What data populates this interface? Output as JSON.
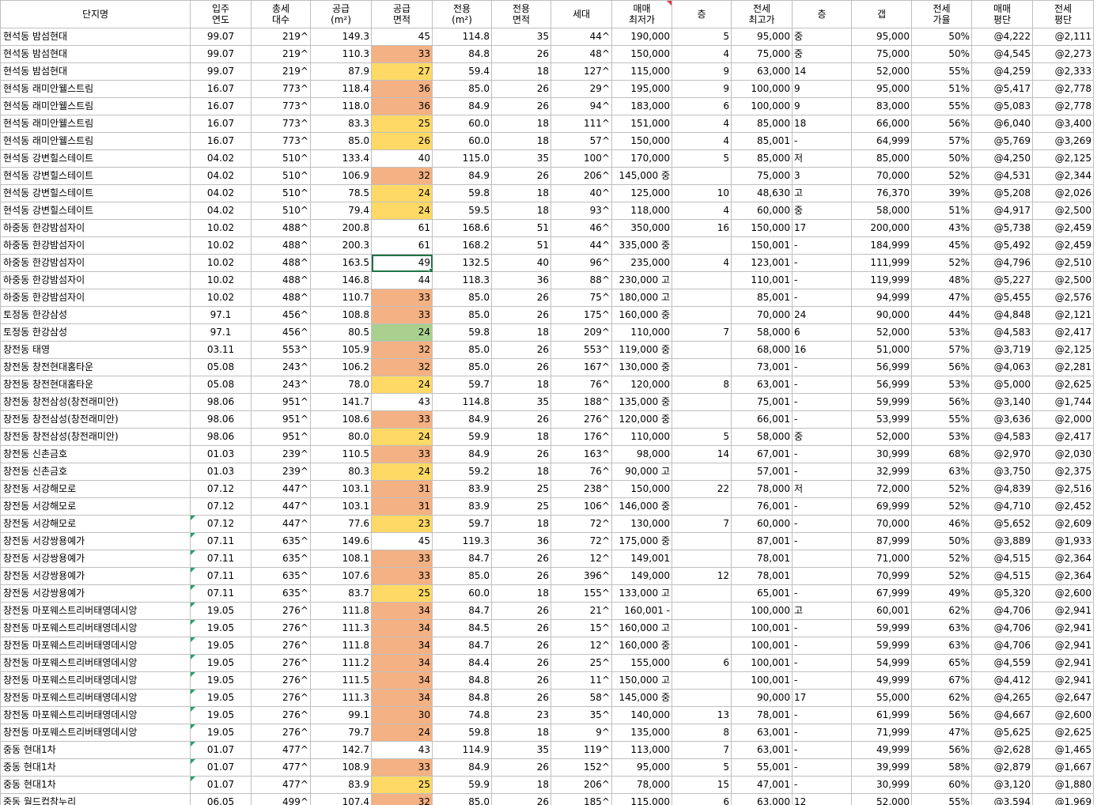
{
  "colors": {
    "orange": "#f4b183",
    "yellow": "#ffd966",
    "green": "#a9d08e",
    "select": "#217346",
    "note_marker": "#e23a3a",
    "error_marker": "#21a366"
  },
  "headers": [
    {
      "key": "name",
      "lines": [
        "단지명"
      ]
    },
    {
      "key": "year",
      "lines": [
        "입주",
        "연도"
      ]
    },
    {
      "key": "units",
      "lines": [
        "총세",
        "대수"
      ]
    },
    {
      "key": "supply",
      "lines": [
        "공급",
        "(m²)"
      ]
    },
    {
      "key": "supply_py",
      "lines": [
        "공급",
        "면적"
      ]
    },
    {
      "key": "excl",
      "lines": [
        "전용",
        "(m²)"
      ]
    },
    {
      "key": "excl_py",
      "lines": [
        "전용",
        "면적"
      ]
    },
    {
      "key": "hh",
      "lines": [
        "세대"
      ]
    },
    {
      "key": "sale_min",
      "lines": [
        "매매",
        "최저가"
      ]
    },
    {
      "key": "floor1",
      "lines": [
        "층"
      ]
    },
    {
      "key": "rent_max",
      "lines": [
        "전세",
        "최고가"
      ]
    },
    {
      "key": "floor2",
      "lines": [
        "층"
      ]
    },
    {
      "key": "gap",
      "lines": [
        "갭"
      ]
    },
    {
      "key": "rent_rate",
      "lines": [
        "전세",
        "가율"
      ]
    },
    {
      "key": "sale_pp",
      "lines": [
        "매매",
        "평단"
      ]
    },
    {
      "key": "rent_pp",
      "lines": [
        "전세",
        "평단"
      ]
    }
  ],
  "rows": [
    [
      "현석동 밤섬현대",
      "99.07",
      "219^",
      "149.3",
      "45",
      "114.8",
      "35",
      "44^",
      "190,000",
      "5",
      "95,000",
      "중",
      "95,000",
      "50%",
      "@4,222",
      "@2,111"
    ],
    [
      "현석동 밤섬현대",
      "99.07",
      "219^",
      "110.3",
      "33",
      "84.8",
      "26",
      "48^",
      "150,000",
      "4",
      "75,000",
      "중",
      "75,000",
      "50%",
      "@4,545",
      "@2,273"
    ],
    [
      "현석동 밤섬현대",
      "99.07",
      "219^",
      "87.9",
      "27",
      "59.4",
      "18",
      "127^",
      "115,000",
      "9",
      "63,000",
      "14",
      "52,000",
      "55%",
      "@4,259",
      "@2,333"
    ],
    [
      "현석동 래미안웰스트림",
      "16.07",
      "773^",
      "118.4",
      "36",
      "85.0",
      "26",
      "29^",
      "195,000",
      "9",
      "100,000",
      "9",
      "95,000",
      "51%",
      "@5,417",
      "@2,778"
    ],
    [
      "현석동 래미안웰스트림",
      "16.07",
      "773^",
      "118.0",
      "36",
      "84.9",
      "26",
      "94^",
      "183,000",
      "6",
      "100,000",
      "9",
      "83,000",
      "55%",
      "@5,083",
      "@2,778"
    ],
    [
      "현석동 래미안웰스트림",
      "16.07",
      "773^",
      "83.3",
      "25",
      "60.0",
      "18",
      "111^",
      "151,000",
      "4",
      "85,000",
      "18",
      "66,000",
      "56%",
      "@6,040",
      "@3,400"
    ],
    [
      "현석동 래미안웰스트림",
      "16.07",
      "773^",
      "85.0",
      "26",
      "60.0",
      "18",
      "57^",
      "150,000",
      "4",
      "85,001",
      "-",
      "64,999",
      "57%",
      "@5,769",
      "@3,269"
    ],
    [
      "현석동 강변힐스테이트",
      "04.02",
      "510^",
      "133.4",
      "40",
      "115.0",
      "35",
      "100^",
      "170,000",
      "5",
      "85,000",
      "저",
      "85,000",
      "50%",
      "@4,250",
      "@2,125"
    ],
    [
      "현석동 강변힐스테이트",
      "04.02",
      "510^",
      "106.9",
      "32",
      "84.9",
      "26",
      "206^",
      "145,000 중",
      "",
      "75,000",
      "3",
      "70,000",
      "52%",
      "@4,531",
      "@2,344"
    ],
    [
      "현석동 강변힐스테이트",
      "04.02",
      "510^",
      "78.5",
      "24",
      "59.8",
      "18",
      "40^",
      "125,000",
      "10",
      "48,630",
      "고",
      "76,370",
      "39%",
      "@5,208",
      "@2,026"
    ],
    [
      "현석동 강변힐스테이트",
      "04.02",
      "510^",
      "79.4",
      "24",
      "59.5",
      "18",
      "93^",
      "118,000",
      "4",
      "60,000",
      "중",
      "58,000",
      "51%",
      "@4,917",
      "@2,500"
    ],
    [
      "하중동 한강밤섬자이",
      "10.02",
      "488^",
      "200.8",
      "61",
      "168.6",
      "51",
      "46^",
      "350,000",
      "16",
      "150,000",
      "17",
      "200,000",
      "43%",
      "@5,738",
      "@2,459"
    ],
    [
      "하중동 한강밤섬자이",
      "10.02",
      "488^",
      "200.3",
      "61",
      "168.2",
      "51",
      "44^",
      "335,000 중",
      "",
      "150,001",
      "-",
      "184,999",
      "45%",
      "@5,492",
      "@2,459"
    ],
    [
      "하중동 한강밤섬자이",
      "10.02",
      "488^",
      "163.5",
      "49",
      "132.5",
      "40",
      "96^",
      "235,000",
      "4",
      "123,001",
      "-",
      "111,999",
      "52%",
      "@4,796",
      "@2,510"
    ],
    [
      "하중동 한강밤섬자이",
      "10.02",
      "488^",
      "146.8",
      "44",
      "118.3",
      "36",
      "88^",
      "230,000 고",
      "",
      "110,001",
      "-",
      "119,999",
      "48%",
      "@5,227",
      "@2,500"
    ],
    [
      "하중동 한강밤섬자이",
      "10.02",
      "488^",
      "110.7",
      "33",
      "85.0",
      "26",
      "75^",
      "180,000 고",
      "",
      "85,001",
      "-",
      "94,999",
      "47%",
      "@5,455",
      "@2,576"
    ],
    [
      "토정동 한강삼성",
      "97.1",
      "456^",
      "108.8",
      "33",
      "85.0",
      "26",
      "175^",
      "160,000 중",
      "",
      "70,000",
      "24",
      "90,000",
      "44%",
      "@4,848",
      "@2,121"
    ],
    [
      "토정동 한강삼성",
      "97.1",
      "456^",
      "80.5",
      "24",
      "59.8",
      "18",
      "209^",
      "110,000",
      "7",
      "58,000",
      "6",
      "52,000",
      "53%",
      "@4,583",
      "@2,417"
    ],
    [
      "창전동 태영",
      "03.11",
      "553^",
      "105.9",
      "32",
      "85.0",
      "26",
      "553^",
      "119,000 중",
      "",
      "68,000",
      "16",
      "51,000",
      "57%",
      "@3,719",
      "@2,125"
    ],
    [
      "창전동 창전현대홈타운",
      "05.08",
      "243^",
      "106.2",
      "32",
      "85.0",
      "26",
      "167^",
      "130,000 중",
      "",
      "73,001",
      "-",
      "56,999",
      "56%",
      "@4,063",
      "@2,281"
    ],
    [
      "창전동 창전현대홈타운",
      "05.08",
      "243^",
      "78.0",
      "24",
      "59.7",
      "18",
      "76^",
      "120,000",
      "8",
      "63,001",
      "-",
      "56,999",
      "53%",
      "@5,000",
      "@2,625"
    ],
    [
      "창전동 창전삼성(창전래미안)",
      "98.06",
      "951^",
      "141.7",
      "43",
      "114.8",
      "35",
      "188^",
      "135,000 중",
      "",
      "75,001",
      "-",
      "59,999",
      "56%",
      "@3,140",
      "@1,744"
    ],
    [
      "창전동 창전삼성(창전래미안)",
      "98.06",
      "951^",
      "108.6",
      "33",
      "84.9",
      "26",
      "276^",
      "120,000 중",
      "",
      "66,001",
      "-",
      "53,999",
      "55%",
      "@3,636",
      "@2,000"
    ],
    [
      "창전동 창전삼성(창전래미안)",
      "98.06",
      "951^",
      "80.0",
      "24",
      "59.9",
      "18",
      "176^",
      "110,000",
      "5",
      "58,000",
      "중",
      "52,000",
      "53%",
      "@4,583",
      "@2,417"
    ],
    [
      "창전동 신촌금호",
      "01.03",
      "239^",
      "110.5",
      "33",
      "84.9",
      "26",
      "163^",
      "98,000",
      "14",
      "67,001",
      "-",
      "30,999",
      "68%",
      "@2,970",
      "@2,030"
    ],
    [
      "창전동 신촌금호",
      "01.03",
      "239^",
      "80.3",
      "24",
      "59.2",
      "18",
      "76^",
      "90,000 고",
      "",
      "57,001",
      "-",
      "32,999",
      "63%",
      "@3,750",
      "@2,375"
    ],
    [
      "창전동 서강해모로",
      "07.12",
      "447^",
      "103.1",
      "31",
      "83.9",
      "25",
      "238^",
      "150,000",
      "22",
      "78,000",
      "저",
      "72,000",
      "52%",
      "@4,839",
      "@2,516"
    ],
    [
      "창전동 서강해모로",
      "07.12",
      "447^",
      "103.1",
      "31",
      "83.9",
      "25",
      "106^",
      "146,000 중",
      "",
      "76,001",
      "-",
      "69,999",
      "52%",
      "@4,710",
      "@2,452"
    ],
    [
      "창전동 서강해모로",
      "07.12",
      "447^",
      "77.6",
      "23",
      "59.7",
      "18",
      "72^",
      "130,000",
      "7",
      "60,000",
      "-",
      "70,000",
      "46%",
      "@5,652",
      "@2,609"
    ],
    [
      "창전동 서강쌍용예가",
      "07.11",
      "635^",
      "149.6",
      "45",
      "119.3",
      "36",
      "72^",
      "175,000 중",
      "",
      "87,001",
      "-",
      "87,999",
      "50%",
      "@3,889",
      "@1,933"
    ],
    [
      "창전동 서강쌍용예가",
      "07.11",
      "635^",
      "108.1",
      "33",
      "84.7",
      "26",
      "12^",
      "149,001",
      "",
      "78,001",
      "",
      "71,000",
      "52%",
      "@4,515",
      "@2,364"
    ],
    [
      "창전동 서강쌍용예가",
      "07.11",
      "635^",
      "107.6",
      "33",
      "85.0",
      "26",
      "396^",
      "149,000",
      "12",
      "78,001",
      "",
      "70,999",
      "52%",
      "@4,515",
      "@2,364"
    ],
    [
      "창전동 서강쌍용예가",
      "07.11",
      "635^",
      "83.7",
      "25",
      "60.0",
      "18",
      "155^",
      "133,000 고",
      "",
      "65,001",
      "-",
      "67,999",
      "49%",
      "@5,320",
      "@2,600"
    ],
    [
      "창전동 마포웨스트리버태영데시앙",
      "19.05",
      "276^",
      "111.8",
      "34",
      "84.7",
      "26",
      "21^",
      "160,001 -",
      "",
      "100,000",
      "고",
      "60,001",
      "62%",
      "@4,706",
      "@2,941"
    ],
    [
      "창전동 마포웨스트리버태영데시앙",
      "19.05",
      "276^",
      "111.3",
      "34",
      "84.5",
      "26",
      "15^",
      "160,000 고",
      "",
      "100,001",
      "-",
      "59,999",
      "63%",
      "@4,706",
      "@2,941"
    ],
    [
      "창전동 마포웨스트리버태영데시앙",
      "19.05",
      "276^",
      "111.8",
      "34",
      "84.7",
      "26",
      "12^",
      "160,000 중",
      "",
      "100,001",
      "-",
      "59,999",
      "63%",
      "@4,706",
      "@2,941"
    ],
    [
      "창전동 마포웨스트리버태영데시앙",
      "19.05",
      "276^",
      "111.2",
      "34",
      "84.4",
      "26",
      "25^",
      "155,000",
      "6",
      "100,001",
      "-",
      "54,999",
      "65%",
      "@4,559",
      "@2,941"
    ],
    [
      "창전동 마포웨스트리버태영데시앙",
      "19.05",
      "276^",
      "111.5",
      "34",
      "84.8",
      "26",
      "11^",
      "150,000 고",
      "",
      "100,001",
      "-",
      "49,999",
      "67%",
      "@4,412",
      "@2,941"
    ],
    [
      "창전동 마포웨스트리버태영데시앙",
      "19.05",
      "276^",
      "111.3",
      "34",
      "84.8",
      "26",
      "58^",
      "145,000 중",
      "",
      "90,000",
      "17",
      "55,000",
      "62%",
      "@4,265",
      "@2,647"
    ],
    [
      "창전동 마포웨스트리버태영데시앙",
      "19.05",
      "276^",
      "99.1",
      "30",
      "74.8",
      "23",
      "35^",
      "140,000",
      "13",
      "78,001",
      "-",
      "61,999",
      "56%",
      "@4,667",
      "@2,600"
    ],
    [
      "창전동 마포웨스트리버태영데시앙",
      "19.05",
      "276^",
      "79.7",
      "24",
      "59.8",
      "18",
      "9^",
      "135,000",
      "8",
      "63,001",
      "-",
      "71,999",
      "47%",
      "@5,625",
      "@2,625"
    ],
    [
      "중동 현대1차",
      "01.07",
      "477^",
      "142.7",
      "43",
      "114.9",
      "35",
      "119^",
      "113,000",
      "7",
      "63,001",
      "-",
      "49,999",
      "56%",
      "@2,628",
      "@1,465"
    ],
    [
      "중동 현대1차",
      "01.07",
      "477^",
      "108.9",
      "33",
      "84.9",
      "26",
      "152^",
      "95,000",
      "5",
      "55,001",
      "-",
      "39,999",
      "58%",
      "@2,879",
      "@1,667"
    ],
    [
      "중동 현대1차",
      "01.07",
      "477^",
      "83.9",
      "25",
      "59.9",
      "18",
      "206^",
      "78,000",
      "15",
      "47,001",
      "-",
      "30,999",
      "60%",
      "@3,120",
      "@1,880"
    ],
    [
      "중동 월드컵참누리",
      "06.05",
      "499^",
      "107.4",
      "32",
      "85.0",
      "26",
      "185^",
      "115,000",
      "6",
      "63,000",
      "12",
      "52,000",
      "55%",
      "@3,594",
      "@1,969"
    ]
  ],
  "supply_py_fill": [
    "",
    "o",
    "y",
    "o",
    "o",
    "y",
    "y",
    "",
    "o",
    "y",
    "y",
    "",
    "",
    "",
    "",
    "o",
    "o",
    "g",
    "o",
    "o",
    "y",
    "",
    "o",
    "y",
    "o",
    "y",
    "o",
    "o",
    "y",
    "",
    "o",
    "o",
    "y",
    "o",
    "o",
    "o",
    "o",
    "o",
    "o",
    "o",
    "o",
    "",
    "o",
    "y",
    "o"
  ],
  "selected_row": 13,
  "green_marker_rows_from": 28
}
